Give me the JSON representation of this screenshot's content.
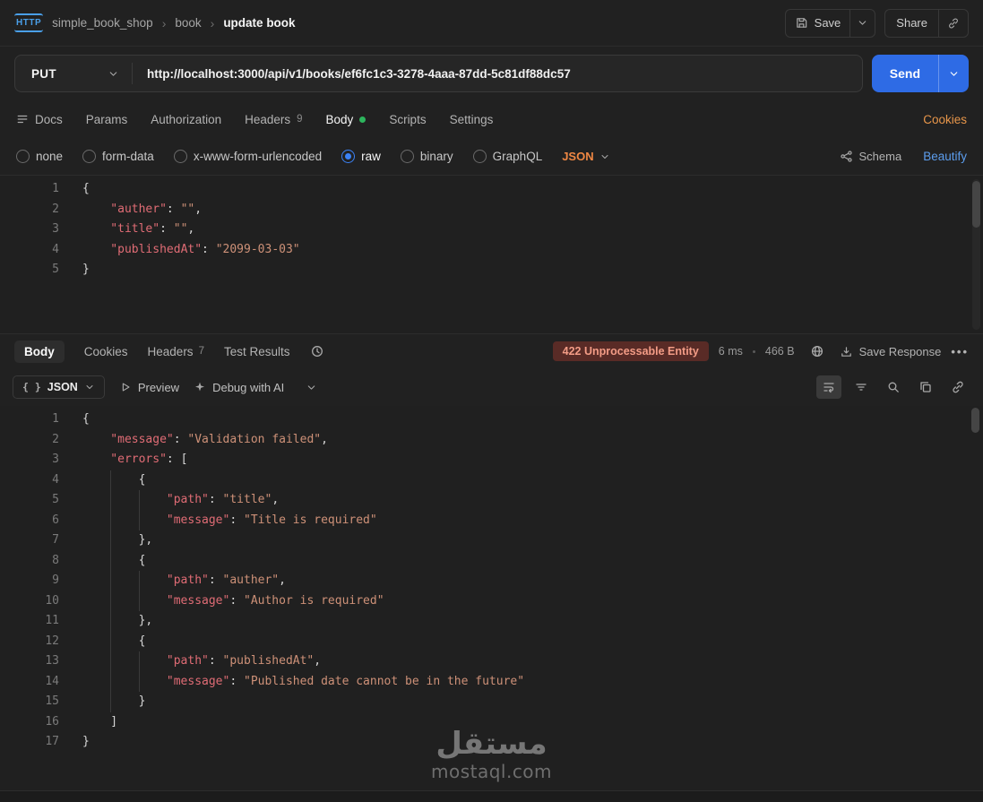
{
  "colors": {
    "accent_blue": "#2e6be5",
    "selected_radio": "#3b82f6",
    "link_orange": "#e8964a",
    "lang_orange": "#ef8743",
    "beautify_blue": "#5c9ded",
    "status_bg": "#592b26",
    "status_text": "#f39c86",
    "green_dot": "#2db55d",
    "tok_key": "#e06c75",
    "tok_string": "#ce9178",
    "tok_punct": "#d6d6d6"
  },
  "header": {
    "logo": "HTTP",
    "breadcrumb": {
      "collection": "simple_book_shop",
      "folder": "book",
      "request": "update book"
    },
    "save": "Save",
    "share": "Share"
  },
  "request": {
    "method": "PUT",
    "url": "http://localhost:3000/api/v1/books/ef6fc1c3-3278-4aaa-87dd-5c81df88dc57",
    "send": "Send",
    "tabs": [
      {
        "label": "Docs"
      },
      {
        "label": "Params"
      },
      {
        "label": "Authorization"
      },
      {
        "label": "Headers",
        "count": "9"
      },
      {
        "label": "Body",
        "active": true
      },
      {
        "label": "Scripts"
      },
      {
        "label": "Settings"
      }
    ],
    "cookies_link": "Cookies",
    "body_modes": [
      {
        "label": "none"
      },
      {
        "label": "form-data"
      },
      {
        "label": "x-www-form-urlencoded"
      },
      {
        "label": "raw",
        "selected": true
      },
      {
        "label": "binary"
      },
      {
        "label": "GraphQL"
      }
    ],
    "language": "JSON",
    "schema": "Schema",
    "beautify": "Beautify",
    "editor_lines": [
      [
        [
          "p",
          "{"
        ]
      ],
      [
        [
          "ind",
          "    "
        ],
        [
          "k",
          "\"auther\""
        ],
        [
          "p",
          ": "
        ],
        [
          "s",
          "\"\""
        ],
        [
          "p",
          ","
        ]
      ],
      [
        [
          "ind",
          "    "
        ],
        [
          "k",
          "\"title\""
        ],
        [
          "p",
          ": "
        ],
        [
          "s",
          "\"\""
        ],
        [
          "p",
          ","
        ]
      ],
      [
        [
          "ind",
          "    "
        ],
        [
          "k",
          "\"publishedAt\""
        ],
        [
          "p",
          ": "
        ],
        [
          "s",
          "\"2099-03-03\""
        ]
      ],
      [
        [
          "p",
          "}"
        ]
      ]
    ]
  },
  "response": {
    "tabs": [
      {
        "label": "Body",
        "active": true
      },
      {
        "label": "Cookies"
      },
      {
        "label": "Headers",
        "count": "7"
      },
      {
        "label": "Test Results"
      }
    ],
    "status": "422 Unprocessable Entity",
    "time": "6 ms",
    "size": "466 B",
    "save_response": "Save Response",
    "more": "•••",
    "viewer": {
      "braces": "{ }",
      "format": "JSON",
      "preview": "Preview",
      "debug_ai": "Debug with AI"
    },
    "editor_lines": [
      [
        [
          "p",
          "{"
        ]
      ],
      [
        [
          "ind",
          "    "
        ],
        [
          "k",
          "\"message\""
        ],
        [
          "p",
          ": "
        ],
        [
          "s",
          "\"Validation failed\""
        ],
        [
          "p",
          ","
        ]
      ],
      [
        [
          "ind",
          "    "
        ],
        [
          "k",
          "\"errors\""
        ],
        [
          "p",
          ": ["
        ]
      ],
      [
        [
          "ind",
          "        "
        ],
        [
          "p",
          "{"
        ]
      ],
      [
        [
          "ind",
          "            "
        ],
        [
          "k",
          "\"path\""
        ],
        [
          "p",
          ": "
        ],
        [
          "s",
          "\"title\""
        ],
        [
          "p",
          ","
        ]
      ],
      [
        [
          "ind",
          "            "
        ],
        [
          "k",
          "\"message\""
        ],
        [
          "p",
          ": "
        ],
        [
          "s",
          "\"Title is required\""
        ]
      ],
      [
        [
          "ind",
          "        "
        ],
        [
          "p",
          "},"
        ]
      ],
      [
        [
          "ind",
          "        "
        ],
        [
          "p",
          "{"
        ]
      ],
      [
        [
          "ind",
          "            "
        ],
        [
          "k",
          "\"path\""
        ],
        [
          "p",
          ": "
        ],
        [
          "s",
          "\"auther\""
        ],
        [
          "p",
          ","
        ]
      ],
      [
        [
          "ind",
          "            "
        ],
        [
          "k",
          "\"message\""
        ],
        [
          "p",
          ": "
        ],
        [
          "s",
          "\"Author is required\""
        ]
      ],
      [
        [
          "ind",
          "        "
        ],
        [
          "p",
          "},"
        ]
      ],
      [
        [
          "ind",
          "        "
        ],
        [
          "p",
          "{"
        ]
      ],
      [
        [
          "ind",
          "            "
        ],
        [
          "k",
          "\"path\""
        ],
        [
          "p",
          ": "
        ],
        [
          "s",
          "\"publishedAt\""
        ],
        [
          "p",
          ","
        ]
      ],
      [
        [
          "ind",
          "            "
        ],
        [
          "k",
          "\"message\""
        ],
        [
          "p",
          ": "
        ],
        [
          "s",
          "\"Published date cannot be in the future\""
        ]
      ],
      [
        [
          "ind",
          "        "
        ],
        [
          "p",
          "}"
        ]
      ],
      [
        [
          "ind",
          "    "
        ],
        [
          "p",
          "]"
        ]
      ],
      [
        [
          "p",
          "}"
        ]
      ]
    ]
  },
  "watermark": {
    "arabic": "مستقل",
    "latin": "mostaql.com"
  }
}
